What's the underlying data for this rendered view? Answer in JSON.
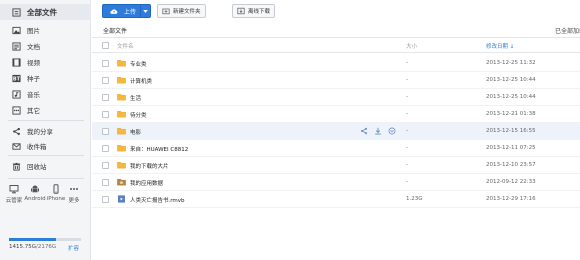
{
  "sidebar": {
    "items": [
      {
        "label": "全部文件",
        "icon": "files-icon"
      },
      {
        "label": "图片",
        "icon": "image-icon"
      },
      {
        "label": "文档",
        "icon": "document-icon"
      },
      {
        "label": "视频",
        "icon": "video-icon"
      },
      {
        "label": "种子",
        "icon": "bt-icon"
      },
      {
        "label": "音乐",
        "icon": "music-icon"
      },
      {
        "label": "其它",
        "icon": "other-icon"
      },
      {
        "label": "我的分享",
        "icon": "share-icon"
      },
      {
        "label": "收件箱",
        "icon": "inbox-icon"
      },
      {
        "label": "回收站",
        "icon": "trash-icon"
      }
    ],
    "devices": [
      {
        "label": "云管家",
        "icon": "monitor-icon"
      },
      {
        "label": "Android",
        "icon": "android-icon"
      },
      {
        "label": "iPhone",
        "icon": "iphone-icon"
      },
      {
        "label": "更多",
        "icon": "more-icon"
      }
    ],
    "quota": {
      "used": "1415.75G",
      "total": "/2176G",
      "fraction": 0.65,
      "expand_label": "扩容"
    }
  },
  "toolbar": {
    "upload_label": "上传",
    "new_folder_label": "新建文件夹",
    "offline_download_label": "离线下载"
  },
  "breadcrumb": {
    "current": "全部文件",
    "status": "已全部加载"
  },
  "columns": {
    "name": "文件名",
    "size": "大小",
    "date": "修改日期"
  },
  "colors": {
    "accent": "#2e7dd6",
    "folder": "#f5b83d",
    "hover_row": "#eef3fb"
  },
  "files": [
    {
      "name": "专业类",
      "type": "folder",
      "size": "-",
      "date": "2013-12-25 11:32"
    },
    {
      "name": "计算机类",
      "type": "folder",
      "size": "-",
      "date": "2013-12-25 10:44"
    },
    {
      "name": "生活",
      "type": "folder",
      "size": "-",
      "date": "2013-12-25 10:44"
    },
    {
      "name": "待分类",
      "type": "folder",
      "size": "-",
      "date": "2013-12-21 01:38"
    },
    {
      "name": "电影",
      "type": "folder",
      "size": "-",
      "date": "2013-12-15 16:55"
    },
    {
      "name": "来自：HUAWEI C8812",
      "type": "folder",
      "size": "-",
      "date": "2013-12-11 07:25"
    },
    {
      "name": "我的下载的大片",
      "type": "folder",
      "size": "-",
      "date": "2013-12-10 23:57"
    },
    {
      "name": "我的应用数据",
      "type": "app-folder",
      "size": "-",
      "date": "2012-09-12 22:33"
    },
    {
      "name": "人类灭亡报告书.rmvb",
      "type": "video",
      "size": "1.23G",
      "date": "2013-12-29 17:16"
    }
  ]
}
